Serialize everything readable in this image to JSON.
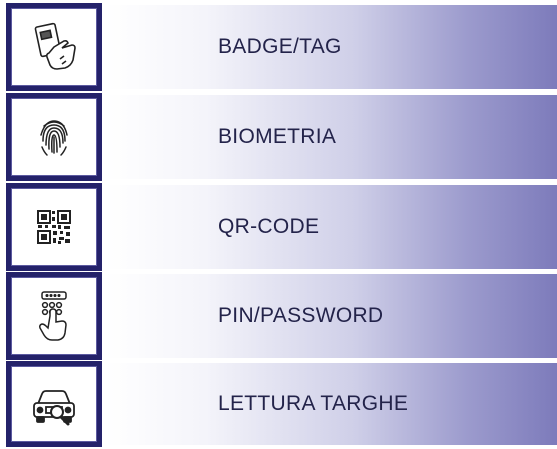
{
  "items": [
    {
      "label": "BADGE/TAG",
      "icon": "badge-tap-icon"
    },
    {
      "label": "BIOMETRIA",
      "icon": "fingerprint-icon"
    },
    {
      "label": "QR-CODE",
      "icon": "qr-code-icon"
    },
    {
      "label": "PIN/PASSWORD",
      "icon": "keypad-pin-icon"
    },
    {
      "label": "LETTURA TARGHE",
      "icon": "license-plate-car-icon"
    }
  ],
  "colors": {
    "frame": "#24226a",
    "text": "#23234a",
    "gradient_end": "#7d7bbb"
  }
}
